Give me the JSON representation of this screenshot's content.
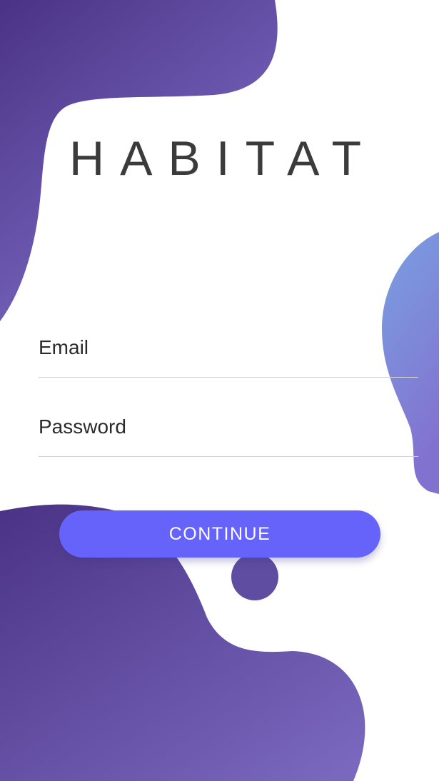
{
  "app": {
    "title": "HABITAT"
  },
  "login": {
    "email_placeholder": "Email",
    "password_placeholder": "Password",
    "continue_label": "CONTINUE"
  },
  "colors": {
    "accent": "#6663fb",
    "blob_dark": "#4c3488",
    "blob_light": "#7d6ac4",
    "blob_blue": "#7a9ee0",
    "text": "#3b3b3b"
  }
}
